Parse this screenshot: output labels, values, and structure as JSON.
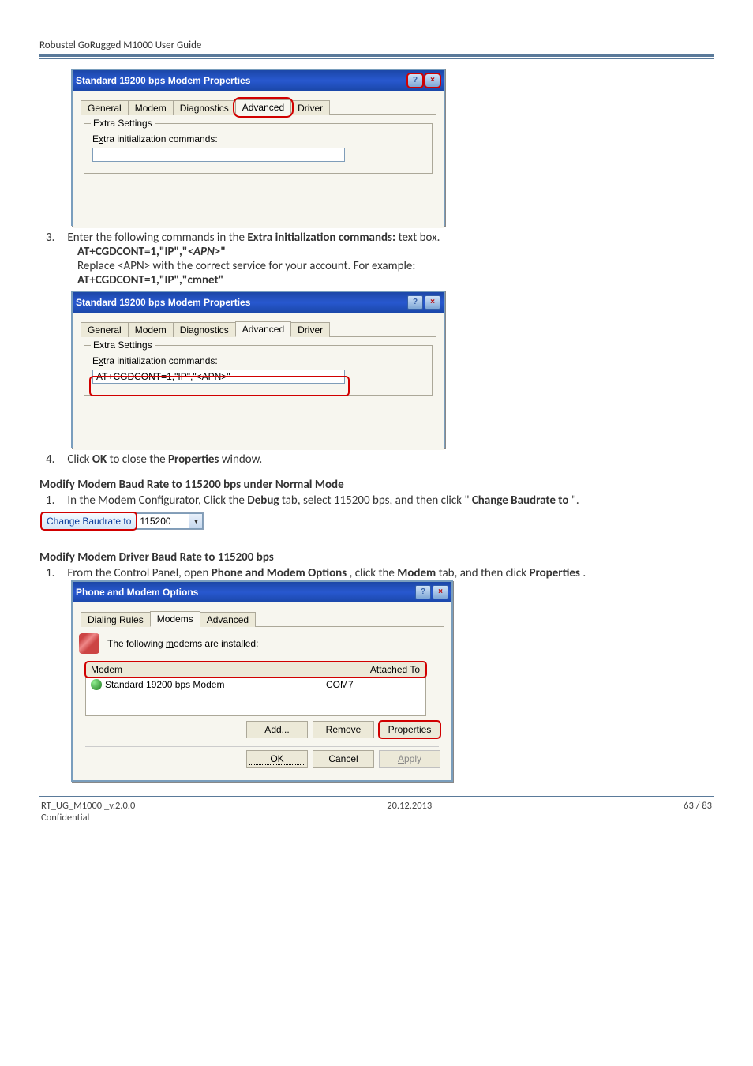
{
  "header": {
    "title": "Robustel GoRugged M1000 User Guide"
  },
  "dialog1": {
    "title": "Standard 19200 bps Modem Properties",
    "tabs": [
      "General",
      "Modem",
      "Diagnostics",
      "Advanced",
      "Driver"
    ],
    "active_tab": "Advanced",
    "group_legend": "Extra Settings",
    "field_label": "Extra initialization commands:",
    "input_value": ""
  },
  "step3": {
    "num": "3.",
    "line1_a": "Enter the following commands in the ",
    "line1_b": "Extra initialization commands:",
    "line1_c": " text box.",
    "line2_a": "AT+CGDCONT=1,\"IP\",\"",
    "line2_b": "<APN>",
    "line2_c": "\"",
    "line3": "Replace <APN> with the correct service for your account. For example:",
    "line4": "AT+CGDCONT=1,\"IP\",\"cmnet\""
  },
  "dialog2": {
    "title": "Standard 19200 bps Modem Properties",
    "tabs": [
      "General",
      "Modem",
      "Diagnostics",
      "Advanced",
      "Driver"
    ],
    "active_tab": "Advanced",
    "group_legend": "Extra Settings",
    "field_label": "Extra initialization commands:",
    "input_value": "AT+CGDCONT=1,\"IP\",\"<APN>\""
  },
  "step4": {
    "num": "4.",
    "a": "Click ",
    "b": "OK",
    "c": " to close the ",
    "d": "Properties",
    "e": " window."
  },
  "section1": {
    "title": "Modify Modem Baud Rate to 115200 bps under Normal Mode",
    "num": "1.",
    "a": "In the Modem Configurator, Click the ",
    "b": "Debug",
    "c": " tab, select 115200 bps, and then click \"",
    "d": "Change Baudrate to",
    "e": "\"."
  },
  "baud": {
    "button_label": "Change Baudrate to",
    "value": "115200"
  },
  "section2": {
    "title": "Modify Modem Driver Baud Rate to 115200 bps",
    "num": "1.",
    "a": "From the Control Panel, open ",
    "b": "Phone and Modem Options",
    "c": ", click the ",
    "d": "Modem",
    "e": " tab, and then click ",
    "f": "Properties",
    "g": "."
  },
  "dialog3": {
    "title": "Phone and Modem Options",
    "tabs": [
      "Dialing Rules",
      "Modems",
      "Advanced"
    ],
    "active_tab": "Modems",
    "instruction": "The following modems are  installed:",
    "col_modem": "Modem",
    "col_attached": "Attached To",
    "row_modem": "Standard 19200 bps Modem",
    "row_port": "COM7",
    "btn_add": "Add...",
    "btn_remove": "Remove",
    "btn_properties": "Properties",
    "btn_ok": "OK",
    "btn_cancel": "Cancel",
    "btn_apply": "Apply"
  },
  "footer": {
    "left1": "RT_UG_M1000 _v.2.0.0",
    "left2": "Confidential",
    "center": "20.12.2013",
    "right": "63 / 83"
  },
  "glyph": {
    "question": "?",
    "close": "×",
    "tridown": "▼"
  }
}
